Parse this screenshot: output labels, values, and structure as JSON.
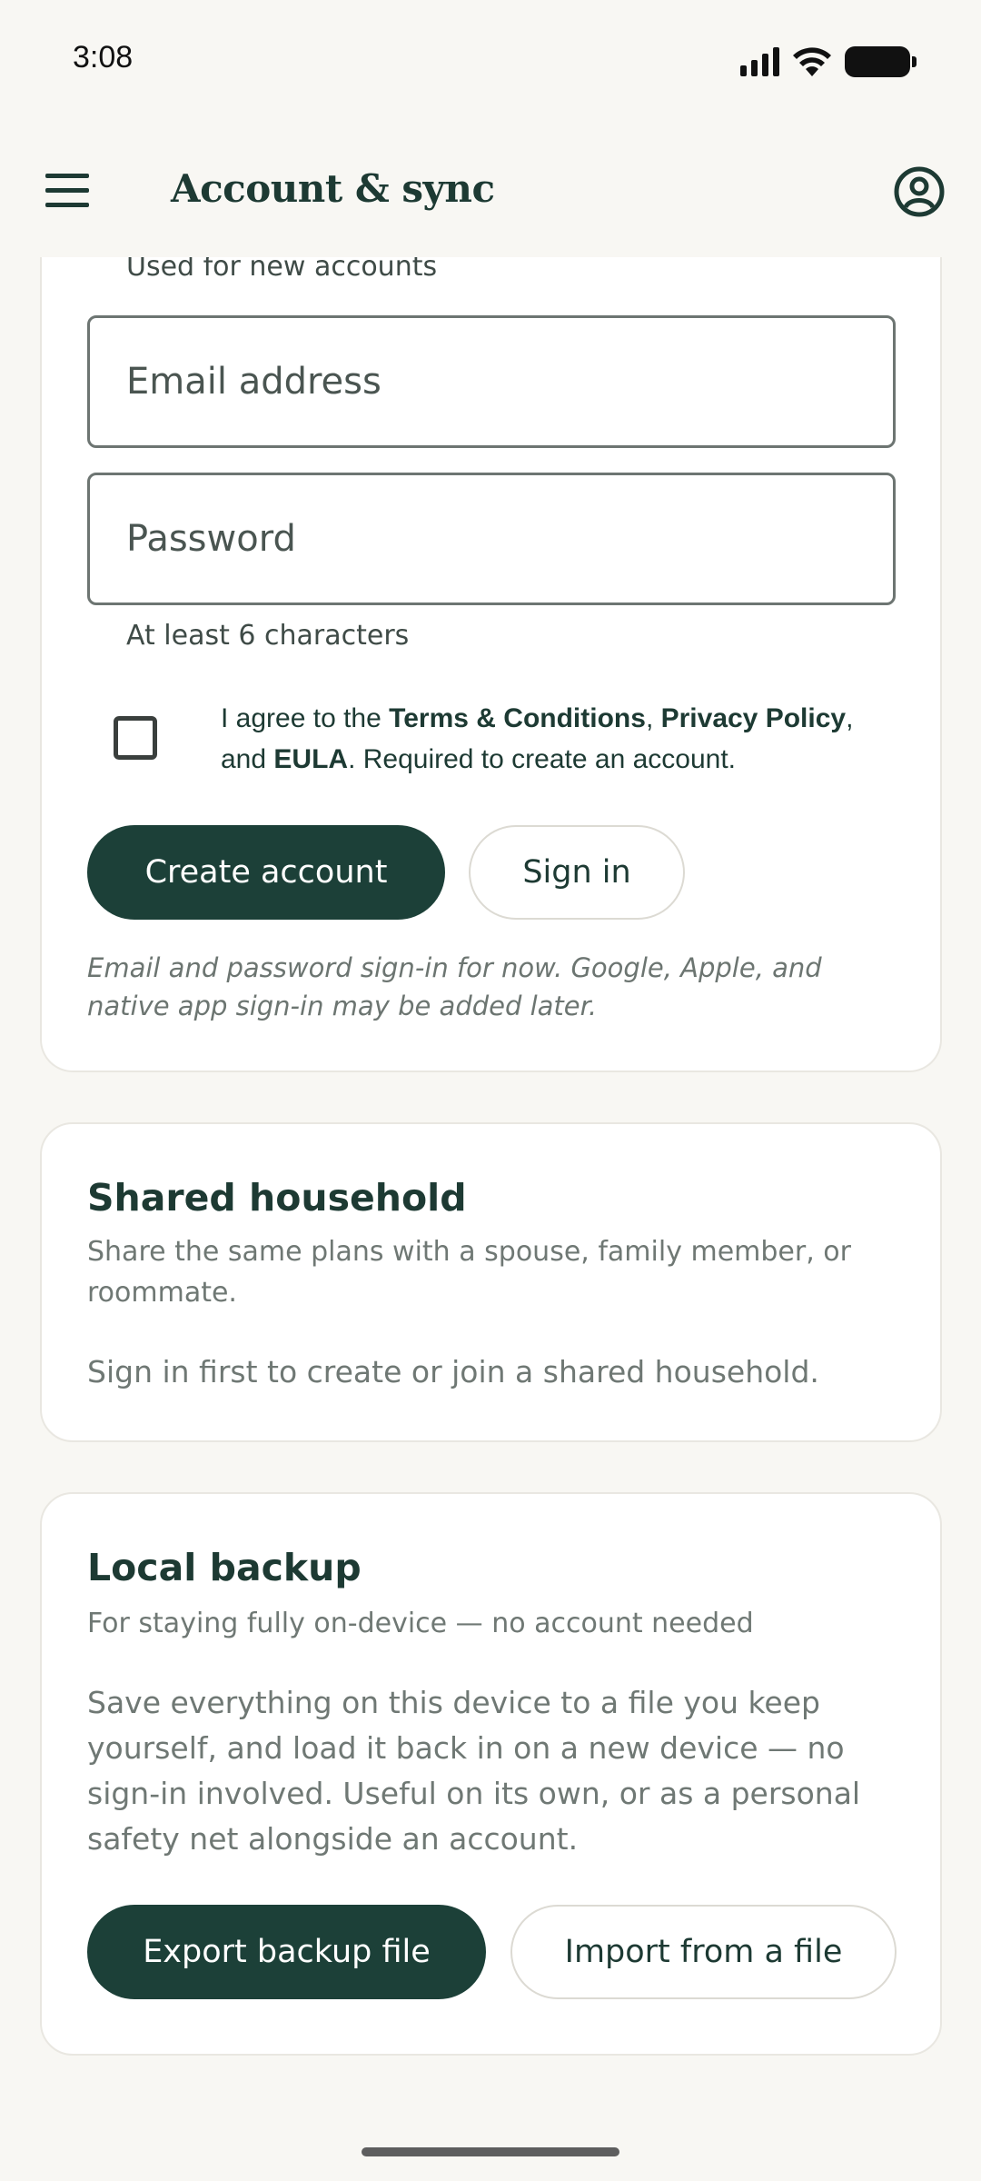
{
  "status_bar": {
    "time": "3:08"
  },
  "app_bar": {
    "title": "Account & sync",
    "menu_icon": "hamburger-menu-icon",
    "profile_icon": "account-circle-icon"
  },
  "account": {
    "email_helper": "Used for new accounts",
    "email_placeholder": "Email address",
    "email_value": "",
    "password_placeholder": "Password",
    "password_value": "",
    "password_helper": "At least 6 characters",
    "agree": {
      "checked": false,
      "prefix": "I agree to the ",
      "terms": "Terms & Conditions",
      "sep1": ", ",
      "privacy": "Privacy Policy",
      "sep2": ", and ",
      "eula": "EULA",
      "suffix": ". Required to create an account."
    },
    "create_label": "Create account",
    "signin_label": "Sign in",
    "note": "Email and password sign-in for now. Google, Apple, and native app sign-in may be added later."
  },
  "household": {
    "title": "Shared household",
    "subtitle": "Share the same plans with a spouse, family member, or roommate.",
    "body": "Sign in first to create or join a shared household."
  },
  "backup": {
    "title": "Local backup",
    "subtitle": "For staying fully on-device — no account needed",
    "body": "Save everything on this device to a file you keep yourself, and load it back in on a new device — no sign-in involved. Useful on its own, or as a personal safety net alongside an account.",
    "export_label": "Export backup file",
    "import_label": "Import from a file"
  },
  "colors": {
    "primary": "#1c4038",
    "background": "#f8f7f3",
    "muted_text": "#6f7874"
  }
}
